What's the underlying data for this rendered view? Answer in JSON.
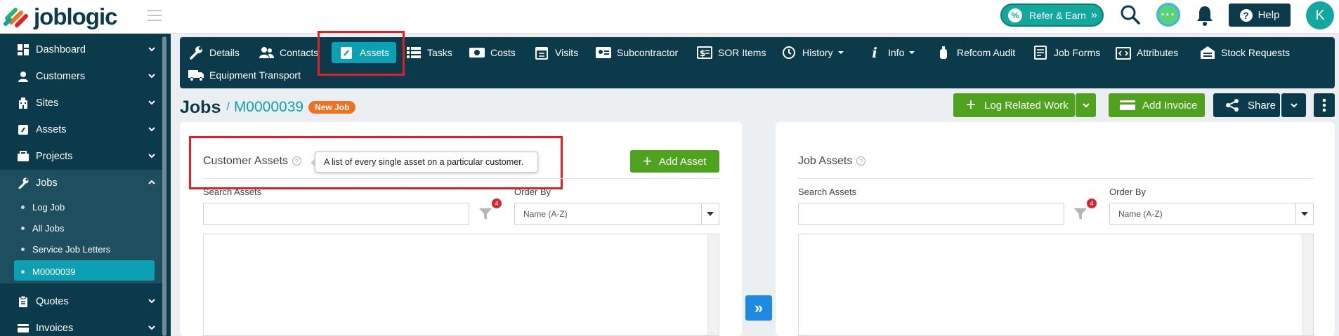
{
  "brand": {
    "name": "joblogic"
  },
  "topbar": {
    "refer_label": "Refer & Earn",
    "refer_arrow": "»",
    "help_label": "Help",
    "avatar_initial": "K"
  },
  "sidebar": {
    "items": [
      {
        "label": "Dashboard",
        "icon": "dashboard-icon"
      },
      {
        "label": "Customers",
        "icon": "user-icon"
      },
      {
        "label": "Sites",
        "icon": "building-icon"
      },
      {
        "label": "Assets",
        "icon": "asset-icon"
      },
      {
        "label": "Projects",
        "icon": "projects-icon"
      },
      {
        "label": "Jobs",
        "icon": "wrench-icon"
      },
      {
        "label": "Quotes",
        "icon": "clipboard-icon"
      },
      {
        "label": "Invoices",
        "icon": "invoice-icon"
      }
    ],
    "jobs_sub": [
      {
        "label": "Log Job"
      },
      {
        "label": "All Jobs"
      },
      {
        "label": "Service Job Letters"
      },
      {
        "label": "M0000039"
      }
    ]
  },
  "tabs": {
    "details": "Details",
    "contacts": "Contacts",
    "assets": "Assets",
    "tasks": "Tasks",
    "costs": "Costs",
    "visits": "Visits",
    "subcontractor": "Subcontractor",
    "sor_items": "SOR Items",
    "history": "History",
    "info": "Info",
    "refcom_audit": "Refcom Audit",
    "job_forms": "Job Forms",
    "attributes": "Attributes",
    "stock_requests": "Stock Requests",
    "equipment_transport": "Equipment Transport"
  },
  "header": {
    "title": "Jobs",
    "separator": "/",
    "job_number": "M0000039",
    "status_badge": "New Job",
    "log_related_work": "Log Related Work",
    "add_invoice": "Add Invoice",
    "share": "Share"
  },
  "customer_assets": {
    "title": "Customer Assets",
    "help_mark": "?",
    "tooltip": "A list of every single asset on a particular customer.",
    "add_asset": "Add Asset",
    "search_label": "Search Assets",
    "search_value": "",
    "filter_count": "4",
    "order_label": "Order By",
    "order_value": "Name (A-Z)"
  },
  "job_assets": {
    "title": "Job Assets",
    "help_mark": "?",
    "search_label": "Search Assets",
    "search_value": "",
    "filter_count": "4",
    "order_label": "Order By",
    "order_value": "Name (A-Z)"
  },
  "transfer": {
    "label": "»"
  },
  "colors": {
    "navy": "#0b3b4a",
    "teal": "#0d9fb3",
    "green": "#4fa21e",
    "orange": "#f37021",
    "highlight_red": "#e01f26"
  }
}
